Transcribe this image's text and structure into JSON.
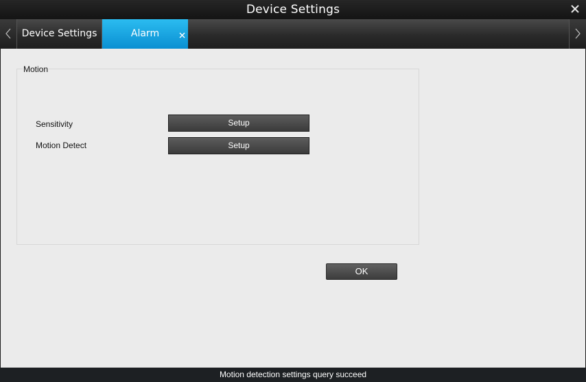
{
  "window": {
    "title": "Device Settings"
  },
  "tabs": [
    {
      "label": "Device Settings",
      "active": false
    },
    {
      "label": "Alarm",
      "active": true
    }
  ],
  "motion_group": {
    "title": "Motion",
    "rows": [
      {
        "label": "Sensitivity",
        "button": "Setup"
      },
      {
        "label": "Motion Detect",
        "button": "Setup"
      }
    ]
  },
  "footer": {
    "ok_label": "OK"
  },
  "status": {
    "message": "Motion detection settings query succeed"
  },
  "colors": {
    "active_tab": "#1aa7e6",
    "content_bg": "#ebebeb",
    "titlebar": "#1c1c1c"
  },
  "icons": {
    "close": "close-icon",
    "tab_close": "tab-close-icon",
    "scroll_left": "chevron-left-icon",
    "scroll_right": "chevron-right-icon"
  }
}
